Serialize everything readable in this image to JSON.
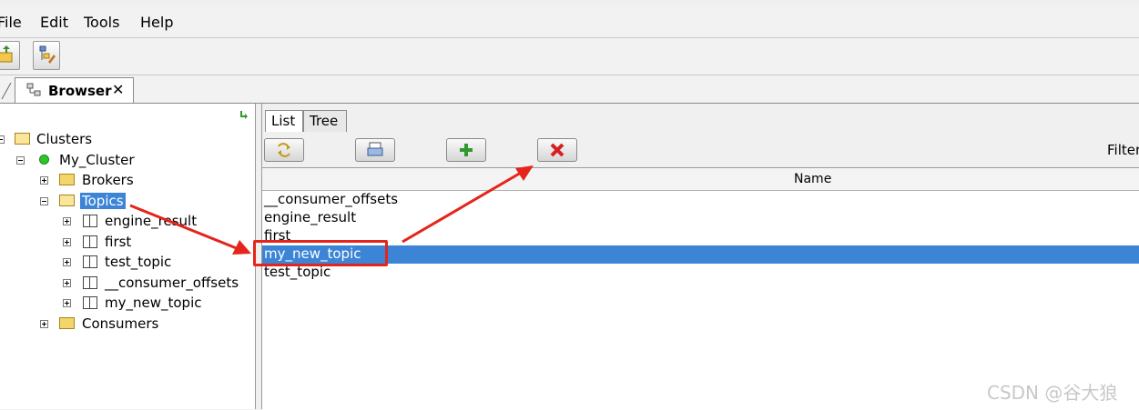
{
  "menu": {
    "items": [
      {
        "label": "File",
        "mnemonic": "F",
        "rest": "ile"
      },
      {
        "label": "Edit",
        "mnemonic": "E",
        "rest": "dit"
      },
      {
        "label": "Tools",
        "mnemonic": "T",
        "rest": "ools"
      },
      {
        "label": "Help",
        "mnemonic": "H",
        "rest": "elp"
      }
    ]
  },
  "toolbar": {
    "buttons": [
      {
        "icon": "add-cluster-icon"
      },
      {
        "icon": "edit-tree-icon"
      }
    ]
  },
  "browser_tab": {
    "label": "Browser",
    "close": "✕"
  },
  "tree": {
    "root": "Clusters",
    "cluster": "My_Cluster",
    "brokers": "Brokers",
    "topics": "Topics",
    "topic_items": [
      "engine_result",
      "first",
      "test_topic",
      "__consumer_offsets",
      "my_new_topic"
    ],
    "consumers": "Consumers"
  },
  "right": {
    "tabs": [
      "List",
      "Tree"
    ],
    "action_buttons": [
      "refresh-icon",
      "print-icon",
      "add-icon",
      "delete-icon"
    ],
    "filter_label": "Filter",
    "column_header": "Name",
    "rows": [
      "__consumer_offsets",
      "engine_result",
      "first",
      "my_new_topic",
      "test_topic"
    ],
    "selected_row": "my_new_topic"
  },
  "watermark": "CSDN @谷大狼",
  "colors": {
    "selection": "#3b84d6",
    "annotation": "#e5241b"
  }
}
